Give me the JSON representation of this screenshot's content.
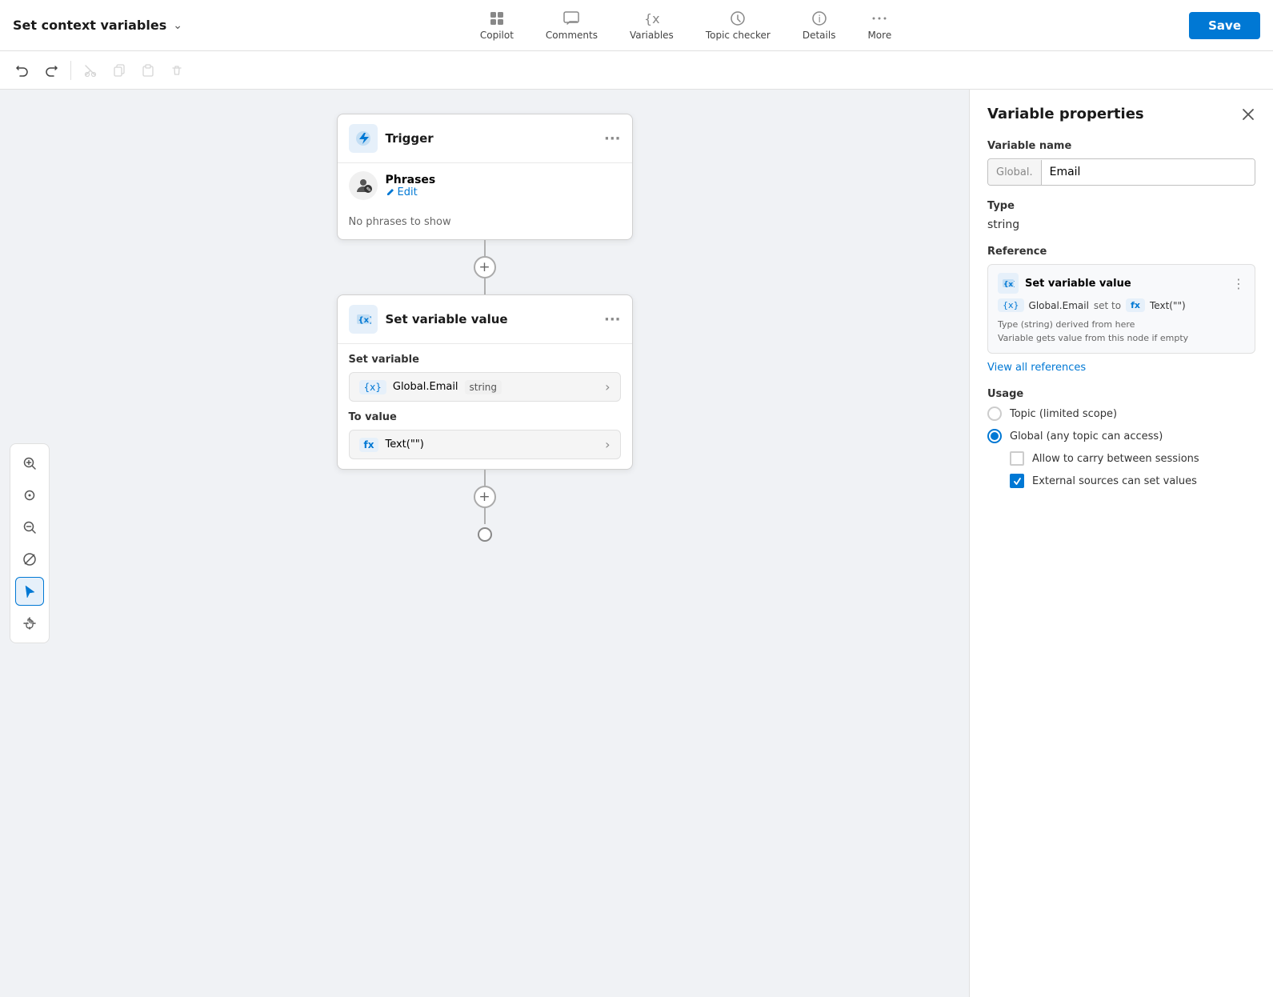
{
  "topbar": {
    "title": "Set context variables",
    "actions": [
      {
        "id": "copilot",
        "label": "Copilot"
      },
      {
        "id": "comments",
        "label": "Comments"
      },
      {
        "id": "variables",
        "label": "Variables"
      },
      {
        "id": "topic_checker",
        "label": "Topic checker"
      },
      {
        "id": "details",
        "label": "Details"
      },
      {
        "id": "more",
        "label": "More"
      }
    ],
    "save_label": "Save"
  },
  "toolbar": {
    "undo": "↩",
    "redo": "↪",
    "cut": "✂",
    "copy": "⧉",
    "paste": "📋",
    "delete": "🗑"
  },
  "canvas": {
    "trigger_node": {
      "title": "Trigger",
      "phrases_label": "Phrases",
      "edit_label": "Edit",
      "phrases_empty": "No phrases to show"
    },
    "set_variable_node": {
      "title": "Set variable value",
      "set_variable_label": "Set variable",
      "variable_name": "Global.Email",
      "variable_type": "string",
      "to_value_label": "To value",
      "to_value": "Text(\"\")"
    }
  },
  "right_panel": {
    "title": "Variable properties",
    "variable_name_section": "Variable name",
    "variable_prefix": "Global.",
    "variable_name_value": "Email",
    "type_section": "Type",
    "type_value": "string",
    "reference_section": "Reference",
    "reference": {
      "title": "Set variable value",
      "var_label": "Global.Email",
      "set_to_label": "set to",
      "fx_label": "fx",
      "value_label": "Text(\"\")",
      "note_line1": "Type (string) derived from here",
      "note_line2": "Variable gets value from this node if empty"
    },
    "view_references_label": "View all references",
    "usage_section": "Usage",
    "usage_options": [
      {
        "label": "Topic (limited scope)",
        "selected": false
      },
      {
        "label": "Global (any topic can access)",
        "selected": true
      }
    ],
    "checkboxes": [
      {
        "label": "Allow to carry between sessions",
        "checked": false
      },
      {
        "label": "External sources can set values",
        "checked": true
      }
    ],
    "close_label": "×"
  },
  "left_tools": [
    {
      "id": "zoom-in",
      "icon": "+",
      "label": "Zoom in"
    },
    {
      "id": "target",
      "icon": "◎",
      "label": "Center"
    },
    {
      "id": "zoom-out",
      "icon": "−",
      "label": "Zoom out"
    },
    {
      "id": "no-action",
      "icon": "⊘",
      "label": "No action"
    },
    {
      "id": "select",
      "icon": "↖",
      "label": "Select",
      "active": true
    },
    {
      "id": "hand",
      "icon": "✋",
      "label": "Pan"
    }
  ]
}
